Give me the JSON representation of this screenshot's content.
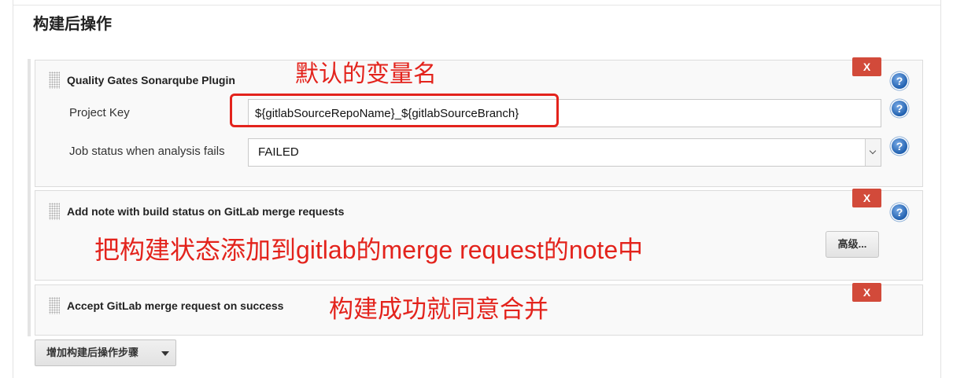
{
  "section_title": "构建后操作",
  "steps": [
    {
      "title": "Quality Gates Sonarqube Plugin",
      "close_label": "X",
      "fields": [
        {
          "label": "Project Key",
          "value": "${gitlabSourceRepoName}_${gitlabSourceBranch}"
        },
        {
          "label": "Job status when analysis fails",
          "value": "FAILED"
        }
      ]
    },
    {
      "title": "Add note with build status on GitLab merge requests",
      "close_label": "X",
      "advanced_label": "高级..."
    },
    {
      "title": "Accept GitLab merge request on success",
      "close_label": "X"
    }
  ],
  "add_step_button": {
    "label": "增加构建后操作步骤"
  },
  "annotations": {
    "default_var_name": "默认的变量名",
    "add_note": "把构建状态添加到gitlab的merge request的note中",
    "auto_merge": "构建成功就同意合并"
  },
  "icons": {
    "help": "help-icon",
    "drag": "drag-handle-icon",
    "dropdown": "chevron-down-icon",
    "add_caret": "caret-down-icon"
  },
  "colors": {
    "close_button": "#d24a3a",
    "help_icon": "#1f5fae",
    "annotation": "#e3231c",
    "step_background": "#f9f9f9"
  }
}
